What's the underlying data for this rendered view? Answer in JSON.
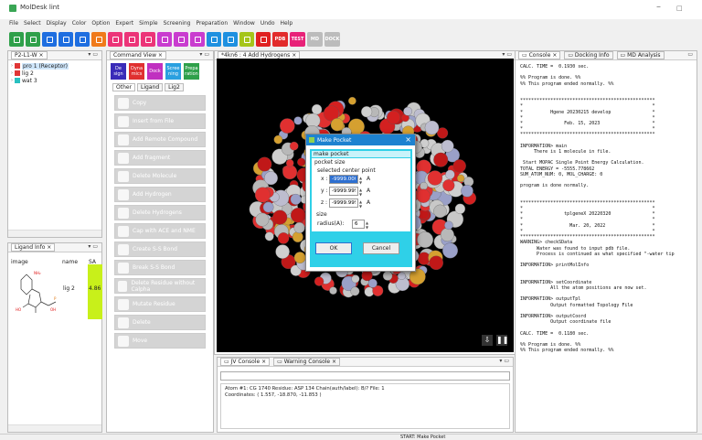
{
  "window": {
    "title": "MolDesk lint"
  },
  "menu": [
    "File",
    "Select",
    "Display",
    "Color",
    "Option",
    "Expert",
    "Simple",
    "Screening",
    "Preparation",
    "Window",
    "Undo",
    "Help"
  ],
  "toolbar": [
    {
      "icon": "enter-icon",
      "color": "#2fa04a"
    },
    {
      "icon": "exit-icon",
      "color": "#2fa04a"
    },
    {
      "icon": "back-icon",
      "color": "#1e6ee0"
    },
    {
      "icon": "select-icon",
      "color": "#1e6ee0"
    },
    {
      "icon": "target-icon",
      "color": "#1e6ee0"
    },
    {
      "icon": "warning-icon",
      "color": "#f07a1a"
    },
    {
      "icon": "scissors-icon",
      "color": "#ec3478"
    },
    {
      "icon": "refresh-icon",
      "color": "#ec3478"
    },
    {
      "icon": "pencil-icon",
      "color": "#ec3478"
    },
    {
      "icon": "hide-icon",
      "color": "#c93ccf"
    },
    {
      "icon": "label-icon",
      "color": "#c93ccf"
    },
    {
      "icon": "eye-icon",
      "color": "#c93ccf"
    },
    {
      "icon": "layers-icon",
      "color": "#1e90e0"
    },
    {
      "icon": "display-icon",
      "color": "#1e90e0"
    },
    {
      "icon": "highlight-icon",
      "color": "#a5c51a"
    },
    {
      "icon": "stop-icon",
      "color": "#e02121"
    },
    {
      "label": "PDB",
      "color": "#e22b2b"
    },
    {
      "label": "TEST",
      "color": "#e82278"
    },
    {
      "label": "MD",
      "color": "#bcbcbc"
    },
    {
      "label": "DOCK",
      "color": "#bcbcbc"
    }
  ],
  "left_top": {
    "tab": "P2-L1-W",
    "items": [
      {
        "label": "pro 1 (Receptor)",
        "color": "#e03535",
        "selected": true
      },
      {
        "label": "lig 2",
        "color": "#e03535"
      },
      {
        "label": "wat 3",
        "color": "#28c0c0"
      }
    ]
  },
  "ligand_info": {
    "tab": "Ligand Info",
    "cols": [
      "image",
      "name",
      "SA"
    ],
    "row": {
      "name": "lig 2",
      "sa": "4.86"
    }
  },
  "command_view": {
    "tab": "Command View",
    "top_buttons": [
      {
        "label": "De sign",
        "color": "#3a2bb8"
      },
      {
        "label": "Dyna mics",
        "color": "#e03030"
      },
      {
        "label": "Dock",
        "color": "#c030c0"
      },
      {
        "label": "Scree ning",
        "color": "#2aa0e0"
      },
      {
        "label": "Prepa ration",
        "color": "#2fa04a"
      }
    ],
    "tabs": [
      "Other",
      "Ligand",
      "Lig2"
    ],
    "commands": [
      "Copy",
      "Insert from File",
      "Add Remote Compound",
      "Add fragment",
      "Delete Molecule",
      "Add Hydrogen",
      "Delete Hydrogens",
      "Cap with ACE and NME",
      "Create S-S Bond",
      "Break S-S Bond",
      "Delete Residue without Calpha",
      "Mutate Residue",
      "Delete",
      "Move"
    ]
  },
  "viewer": {
    "tab": "*4kn6 : 4 Add Hydrogens"
  },
  "dialog": {
    "title": "Make Pocket",
    "header": "make pocket",
    "pocket_size": "pocket size",
    "selected_center": "selected center point",
    "x_label": "x :",
    "x_val": "-9999.000",
    "y_label": "y :",
    "y_val": "-9999.999",
    "z_label": "z :",
    "z_val": "-9999.999",
    "unit": "A",
    "size_label": "size",
    "radius_label": "radius(A):",
    "radius_val": "6",
    "ok": "OK",
    "cancel": "Cancel"
  },
  "jv_console": {
    "tab": "JV Console",
    "warn_tab": "Warning Console",
    "line1": "Atom #1:  CG   1740  Residue: ASP 134  Chain(auth/label): B/?   File: 1",
    "line2": "   Coordinates: ( 1.557, -18.870, -11.853 )"
  },
  "right": {
    "tabs": [
      "Console",
      "Docking Info",
      "MD Analysis"
    ]
  },
  "console_text": "CALC. TIME =  0.1930 sec.\n\n%% Program is done. %%\n%% This program ended normally. %%\n\n\n*************************************************\n*                                               *\n*          Hgene 20230215 develop               *\n*                                               *\n*               Feb. 15, 2023                   *\n*                                               *\n*************************************************\n\nINFORMATION> main\n     There is 1 molecule in file.\n\n Start MOPAC Single Point Energy Calculation.\nTOTAL ENERGY = -5555.778662\nSUM_ATOM_NUM: 0, MOL_CHARGE: 0\n\nprogram is done normally.\n\n\n*************************************************\n*                                               *\n*               tplgeneX 20220320               *\n*                                               *\n*                 Mar. 20, 2022                 *\n*                                               *\n*************************************************\nWARNING> checkSData\n      Water was found to input pdb file.\n      Process is continued as what specified \"-water tip\n\nINFORMATION> printMolInfo\n\n\nINFORMATION> setCoordinate\n           All the atom positions are now set.\n\nINFORMATION> outputTpl\n           Output formatted Topology File\n\nINFORMATION> outputCoord\n           Output coordinate file\n\nCALC. TIME =  0.1180 sec.\n\n%% Program is done. %%\n%% This program ended normally. %%",
  "status": "START: Make Pocket"
}
